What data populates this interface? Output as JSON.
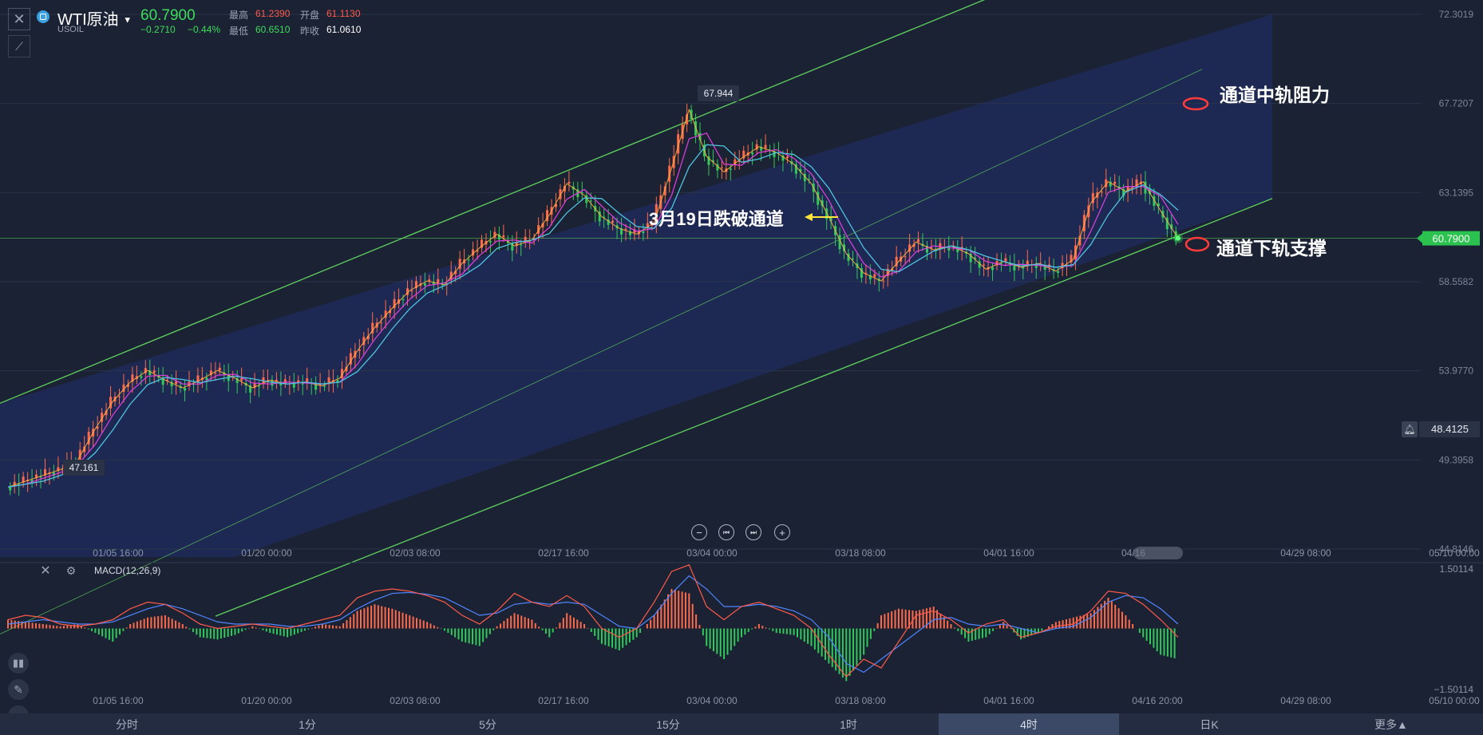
{
  "header": {
    "symbol_name": "WTI原油",
    "symbol_code": "USOIL",
    "last_price": "60.7900",
    "change": "−0.2710",
    "change_pct": "−0.44%",
    "high_label": "最高",
    "high_value": "61.2390",
    "open_label": "开盘",
    "open_value": "61.1130",
    "low_label": "最低",
    "low_value": "60.6510",
    "prev_close_label": "昨收",
    "prev_close_value": "61.0610"
  },
  "annotations": {
    "resistance_label": "通道中轨阻力",
    "breakdown_label": "3月19日跌破通道",
    "support_label": "通道下轨支撑",
    "peak_label": "67.944",
    "trough_label": "47.161"
  },
  "price_axis": {
    "ticks": [
      "72.3019",
      "67.7207",
      "63.1395",
      "58.5582",
      "53.9770",
      "49.3958",
      "44.8146"
    ],
    "current_price_tag": "60.7900",
    "alert_price_tag": "48.4125"
  },
  "time_axis": {
    "ticks": [
      "01/05 16:00",
      "01/20 00:00",
      "02/03 08:00",
      "02/17 16:00",
      "03/04 00:00",
      "03/18 08:00",
      "04/01 16:00",
      "04/16 20:00",
      "04/29 08:00",
      "05/10 00:00"
    ],
    "main_last_tick_obscured": "04/16"
  },
  "macd_panel": {
    "title": "MACD(12,26,9)",
    "ticks": [
      "1.50114",
      "−1.50114"
    ]
  },
  "periods": {
    "items": [
      "分时",
      "1分",
      "5分",
      "15分",
      "1时",
      "4时",
      "日K",
      "更多▲"
    ],
    "active": "4时"
  },
  "colors": {
    "background": "#1b2233",
    "channel_fill": "#1f2a55",
    "channel_line": "#5fd35f",
    "candle_up": "#ff6b4a",
    "candle_down": "#32c95a",
    "ma_magenta": "#e040e0",
    "ma_cyan": "#4ec3e0",
    "macd_line_red": "#ff5a4a",
    "macd_line_blue": "#4f86ff",
    "marker_ellipse": "#ff3b3b",
    "price_tag_bg": "#2cc24f",
    "arrow_yellow": "#ffe53b"
  },
  "chart_data": {
    "type": "line",
    "title": "WTI原油",
    "xlabel": "",
    "ylabel": "",
    "ylim": [
      44.8146,
      72.3019
    ],
    "x": [
      "01/05 16:00",
      "01/20 00:00",
      "02/03 08:00",
      "02/17 16:00",
      "03/04 00:00",
      "03/18 08:00",
      "04/01 16:00",
      "04/16 20:00"
    ],
    "series": [
      {
        "values": [
          48.0,
          48.3,
          48.6,
          48.9,
          49.4,
          51.0,
          52.4,
          53.4,
          54.0,
          53.5,
          53.1,
          53.5,
          54.0,
          53.6,
          53.1,
          53.5,
          53.3,
          53.4,
          53.2,
          53.6,
          55.0,
          56.2,
          57.2,
          58.1,
          58.6,
          58.4,
          59.5,
          60.3,
          61.0,
          60.4,
          60.7,
          62.0,
          63.6,
          63.0,
          61.9,
          61.3,
          61.0,
          61.6,
          64.4,
          67.4,
          65.0,
          64.2,
          64.9,
          65.5,
          65.2,
          64.6,
          63.6,
          61.9,
          60.0,
          59.0,
          58.6,
          59.6,
          60.6,
          60.2,
          60.4,
          60.0,
          59.2,
          59.6,
          59.3,
          59.5,
          59.1,
          59.7,
          62.6,
          63.7,
          63.2,
          63.7,
          62.2,
          60.8
        ]
      }
    ],
    "annotations": [
      "67.944",
      "47.161",
      "3月19日跌破通道",
      "通道中轨阻力",
      "通道下轨支撑"
    ],
    "channel": {
      "upper": [
        [
          "01/05 16:00",
          54.8
        ],
        [
          "04/16 20:00",
          76.7
        ]
      ],
      "middle": [
        [
          "01/05 16:00",
          43.3
        ],
        [
          "04/16 20:00",
          68.4
        ]
      ],
      "lower": [
        [
          "01/20 00:00",
          42.4
        ],
        [
          "04/16 20:00",
          60.5
        ]
      ]
    },
    "current_price": 60.79,
    "macd": {
      "ylim": [
        -1.50114,
        1.50114
      ],
      "histogram": [
        0.2,
        0.15,
        0.1,
        0.05,
        0.1,
        -0.1,
        -0.3,
        0.1,
        0.25,
        0.3,
        0.1,
        -0.2,
        -0.25,
        -0.15,
        0.05,
        -0.1,
        -0.2,
        -0.05,
        0.1,
        0.05,
        0.4,
        0.55,
        0.45,
        0.3,
        0.15,
        -0.05,
        -0.3,
        -0.4,
        0.05,
        0.35,
        0.2,
        -0.2,
        0.35,
        0.1,
        -0.35,
        -0.5,
        -0.2,
        0.3,
        0.9,
        0.8,
        -0.4,
        -0.7,
        -0.2,
        0.1,
        -0.1,
        -0.15,
        -0.4,
        -0.8,
        -1.2,
        -0.6,
        0.3,
        0.45,
        0.4,
        0.5,
        0.1,
        -0.3,
        -0.2,
        0.15,
        -0.25,
        -0.1,
        0.15,
        0.25,
        0.35,
        0.7,
        0.3,
        -0.2,
        -0.6,
        -0.7
      ],
      "macd_line": [
        0.2,
        0.3,
        0.25,
        0.1,
        0.05,
        0.1,
        0.2,
        0.45,
        0.6,
        0.55,
        0.35,
        0.1,
        0.0,
        0.05,
        0.1,
        0.05,
        0.0,
        0.1,
        0.2,
        0.3,
        0.7,
        0.85,
        0.9,
        0.85,
        0.75,
        0.6,
        0.3,
        0.1,
        0.4,
        0.8,
        0.6,
        0.5,
        0.75,
        0.5,
        0.0,
        -0.2,
        0.0,
        0.6,
        1.3,
        1.45,
        0.5,
        0.2,
        0.5,
        0.6,
        0.45,
        0.3,
        0.0,
        -0.6,
        -1.1,
        -0.7,
        -0.9,
        -0.3,
        0.3,
        0.4,
        0.2,
        -0.1,
        0.1,
        0.2,
        -0.2,
        -0.1,
        0.05,
        0.1,
        0.4,
        0.85,
        0.8,
        0.55,
        0.2,
        -0.2
      ],
      "signal_line": [
        0.1,
        0.15,
        0.2,
        0.15,
        0.1,
        0.1,
        0.15,
        0.3,
        0.45,
        0.55,
        0.45,
        0.3,
        0.15,
        0.1,
        0.1,
        0.1,
        0.05,
        0.05,
        0.1,
        0.2,
        0.45,
        0.65,
        0.8,
        0.82,
        0.78,
        0.7,
        0.5,
        0.3,
        0.35,
        0.55,
        0.6,
        0.55,
        0.6,
        0.55,
        0.3,
        0.05,
        0.0,
        0.3,
        0.8,
        1.2,
        0.9,
        0.5,
        0.5,
        0.55,
        0.5,
        0.4,
        0.2,
        -0.2,
        -0.8,
        -1.0,
        -0.7,
        -0.4,
        -0.1,
        0.2,
        0.25,
        0.1,
        0.05,
        0.1,
        0.0,
        -0.1,
        0.0,
        0.05,
        0.25,
        0.6,
        0.75,
        0.7,
        0.45,
        0.1
      ]
    }
  }
}
